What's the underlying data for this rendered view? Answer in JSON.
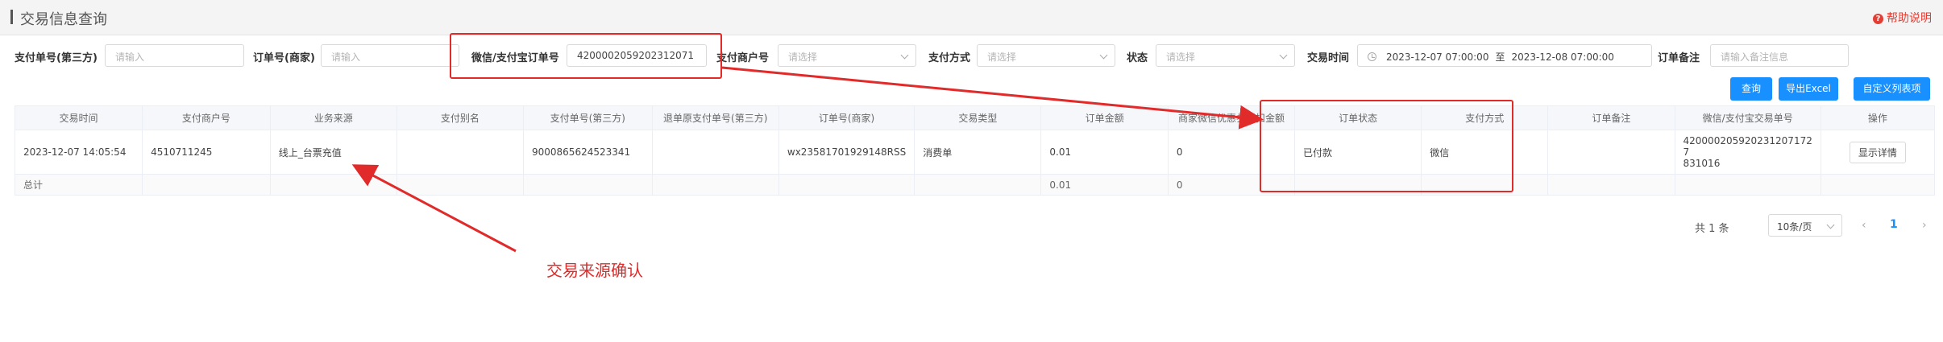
{
  "header": {
    "title": "交易信息查询",
    "help_label": "帮助说明",
    "help_icon": "question-circle-icon"
  },
  "filters": {
    "pay_no_third": {
      "label": "支付单号(第三方)",
      "placeholder": "请输入"
    },
    "order_no_merchant": {
      "label": "订单号(商家)",
      "placeholder": "请输入"
    },
    "wx_ali_order_no": {
      "label": "微信/支付宝订单号",
      "value": "4200002059202312071"
    },
    "merchant_no": {
      "label": "支付商户号",
      "placeholder": "请选择"
    },
    "pay_method": {
      "label": "支付方式",
      "placeholder": "请选择"
    },
    "status": {
      "label": "状态",
      "placeholder": "请选择"
    },
    "trade_time": {
      "label": "交易时间",
      "start": "2023-12-07 07:00:00",
      "separator": "至",
      "end": "2023-12-08 07:00:00"
    },
    "order_remark": {
      "label": "订单备注",
      "placeholder": "请输入备注信息"
    }
  },
  "buttons": {
    "search": "查询",
    "export": "导出Excel",
    "custom_columns": "自定义列表项"
  },
  "table": {
    "columns": [
      "交易时间",
      "支付商户号",
      "业务来源",
      "支付别名",
      "支付单号(第三方)",
      "退单原支付单号(第三方)",
      "订单号(商家)",
      "交易类型",
      "订单金额",
      "商家微信优惠券抵扣金额",
      "订单状态",
      "支付方式",
      "订单备注",
      "微信/支付宝交易单号",
      "操作"
    ],
    "rows": [
      {
        "trade_time": "2023-12-07 14:05:54",
        "merchant_no": "4510711245",
        "biz_source": "线上_台票充值",
        "pay_alias": "",
        "pay_no_third": "9000865624523341",
        "refund_pay_no": "",
        "order_no": "wx23581701929148RSS",
        "trade_type": "消费单",
        "amount": "0.01",
        "coupon_deduct": "0",
        "order_status": "已付款",
        "pay_method": "微信",
        "remark": "",
        "trade_no_line1": "420000205920231207172​7",
        "trade_no_line2": "831016",
        "action": "显示详情"
      }
    ],
    "summary": {
      "label": "总计",
      "amount": "0.01",
      "coupon_deduct": "0"
    }
  },
  "pagination": {
    "total": "共 1 条",
    "page_size": "10条/页",
    "current_page": "1",
    "prev_icon": "chevron-left-icon",
    "next_icon": "chevron-right-icon"
  },
  "annotations": {
    "note": "交易来源确认",
    "color": "#e12a2a"
  },
  "colors": {
    "primary": "#1890ff",
    "annotation": "#e12a2a"
  }
}
